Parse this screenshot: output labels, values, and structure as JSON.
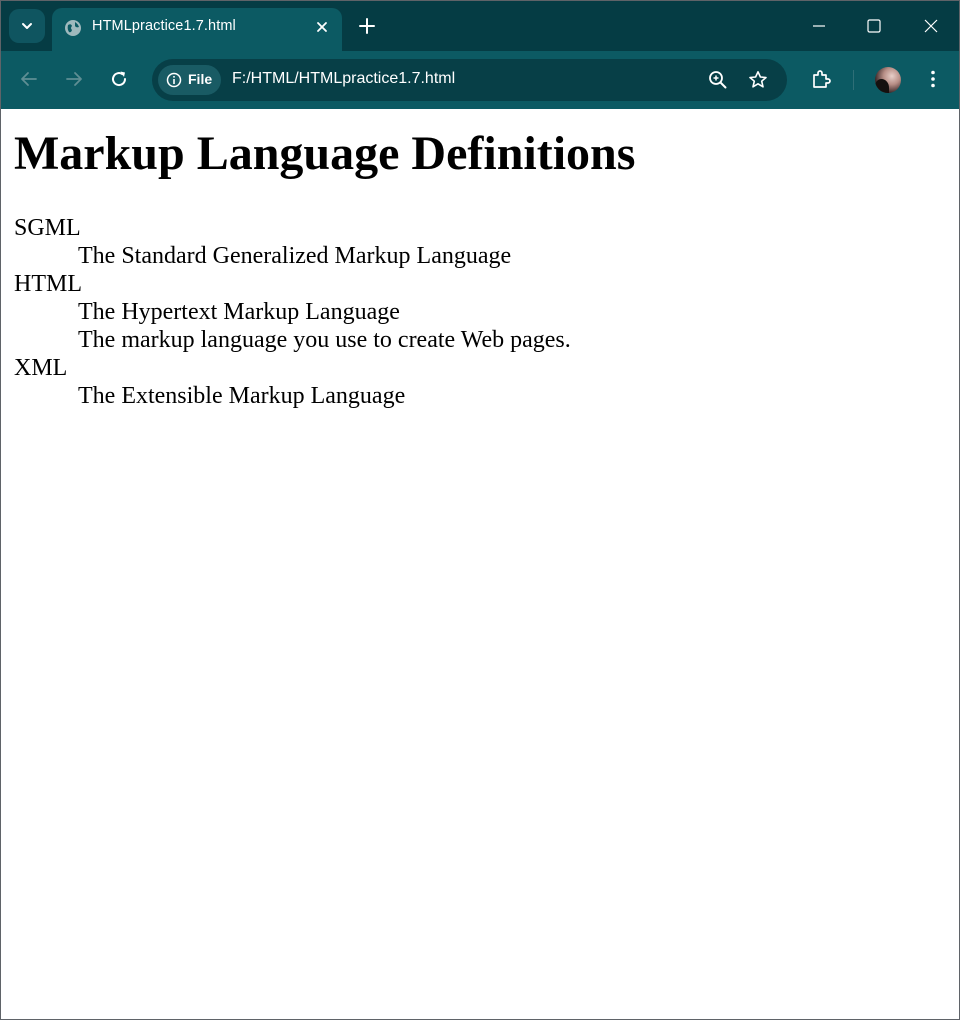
{
  "browser": {
    "tab": {
      "title": "HTMLpractice1.7.html",
      "favicon": "globe-icon"
    },
    "address_bar": {
      "chip_label": "File",
      "url": "F:/HTML/HTMLpractice1.7.html"
    },
    "colors": {
      "frame": "#053c44",
      "toolbar": "#0c5a63",
      "omnibox": "#073f47"
    }
  },
  "page": {
    "heading": "Markup Language Definitions",
    "definitions": [
      {
        "term": "SGML",
        "descriptions": [
          "The Standard Generalized Markup Language"
        ]
      },
      {
        "term": "HTML",
        "descriptions": [
          "The Hypertext Markup Language",
          "The markup language you use to create Web pages."
        ]
      },
      {
        "term": "XML",
        "descriptions": [
          "The Extensible Markup Language"
        ]
      }
    ]
  }
}
